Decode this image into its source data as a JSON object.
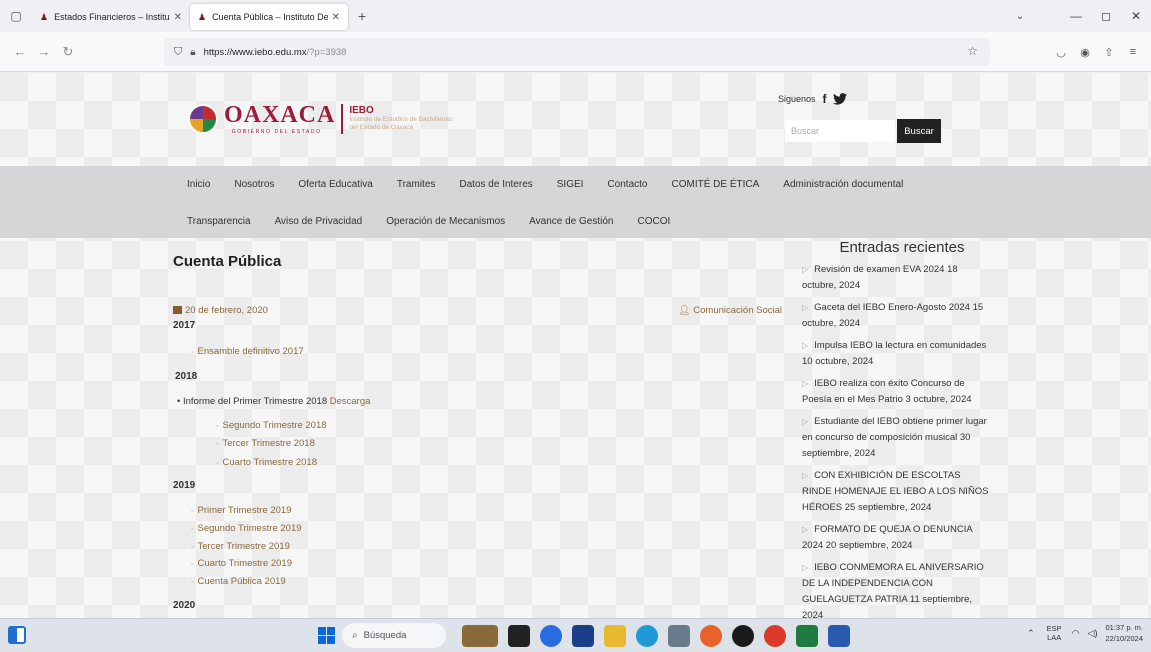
{
  "browser": {
    "tabs": [
      {
        "label": "Estados Financieros – Instituto D",
        "active": false
      },
      {
        "label": "Cuenta Pública – Instituto De E",
        "active": true
      }
    ],
    "new_tab": "+",
    "url_host": "https://www.iebo.edu.mx",
    "url_path": "/?p=3938"
  },
  "header": {
    "logo_main": "OAXACA",
    "logo_sub": "GOBIERNO DEL ESTADO",
    "logo_iebo": "IEBO",
    "logo_iebo_l1": "Instituto de Estudios de Bachillerato",
    "logo_iebo_l2": "del Estado de Oaxaca",
    "follow_label": "Siguenos",
    "facebook": "f",
    "search_placeholder": "Buscar",
    "search_button": "Buscar"
  },
  "menu": {
    "row1": [
      "Inicio",
      "Nosotros",
      "Oferta Educativa",
      "Tramites",
      "Datos de Interes",
      "SIGEI",
      "Contacto",
      "COMITÉ DE ÉTICA",
      "Administración documental"
    ],
    "row2": [
      "Transparencia",
      "Aviso de Privacidad",
      "Operación de Mecanismos",
      "Avance de Gestión",
      "COCOI"
    ]
  },
  "content": {
    "title": "Cuenta Pública",
    "date": "20 de febrero, 2020",
    "author": "Comunicación Social",
    "years": [
      "2017",
      "2018",
      "2019",
      "2020"
    ],
    "y2017": [
      "Ensamble definitivo 2017"
    ],
    "y2018_first_text": "Informe del Primer Trimestre 2018",
    "y2018_first_link": "Descarga",
    "y2018": [
      "Segundo Trimestre 2018",
      "Tercer Trimestre 2018",
      "Cuarto Trimestre 2018"
    ],
    "y2019": [
      "Primer Trimestre 2019",
      "Segundo Trimestre 2019",
      "Tercer Trimestre 2019",
      "Cuarto Trimestre 2019",
      "Cuenta Pública 2019"
    ]
  },
  "sidebar": {
    "title": "Entradas recientes",
    "posts": [
      "Revisión de examen EVA 2024 18 octubre, 2024",
      "Gaceta del IEBO Enero-Agosto 2024 15 octubre, 2024",
      "Impulsa IEBO la lectura en comunidades 10 octubre, 2024",
      "IEBO realiza con éxito Concurso de Poesía en el Mes Patrio 3 octubre, 2024",
      "Estudiante del IEBO obtiene primer lugar en concurso de composición musical 30 septiembre, 2024",
      "CON EXHIBICIÓN DE ESCOLTAS RINDE HOMENAJE EL IEBO A LOS NIÑOS HÉROES 25 septiembre, 2024",
      "FORMATO DE QUEJA O DENUNCIA 2024 20 septiembre, 2024",
      "IEBO CONMEMORA EL ANIVERSARIO DE LA INDEPENDENCIA CON GUELAGUETZA PATRIA 11 septiembre, 2024"
    ]
  },
  "taskbar": {
    "search_label": "Búsqueda",
    "lang1": "ESP",
    "lang2": "LAA",
    "time": "01:37 p. m.",
    "date": "22/10/2024"
  },
  "colors": {
    "brand": "#9c1d3a",
    "link": "#8b6a3a",
    "search_button": "#222222"
  }
}
